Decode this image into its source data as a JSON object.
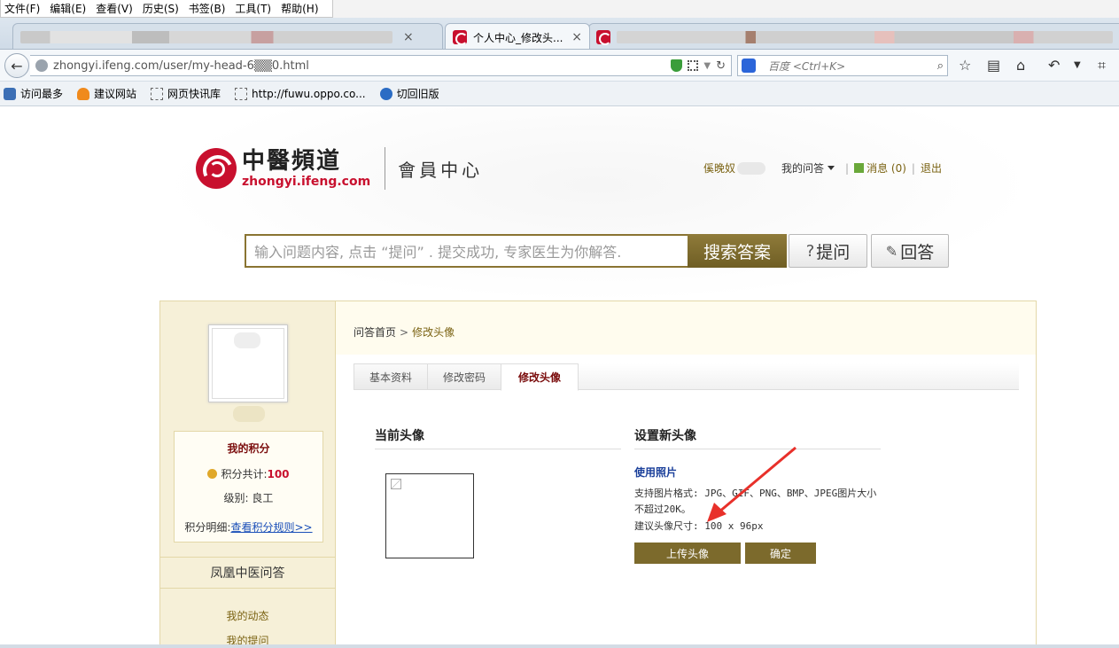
{
  "browser": {
    "menu": [
      "文件(F)",
      "编辑(E)",
      "查看(V)",
      "历史(S)",
      "书签(B)",
      "工具(T)",
      "帮助(H)"
    ],
    "tabs": [
      {
        "title": "",
        "active": false
      },
      {
        "title": "个人中心_修改头...",
        "active": true
      },
      {
        "title": "",
        "active": false
      }
    ],
    "tab_close": "×",
    "url": "zhongyi.ifeng.com/user/my-head-6▒▒0.html",
    "search_placeholder": "百度 <Ctrl+K>",
    "bookmarks": [
      {
        "label": "访问最多",
        "icon": "gear-icon"
      },
      {
        "label": "建议网站",
        "icon": "lightbulb-icon"
      },
      {
        "label": "网页快讯库",
        "icon": "dashed-page-icon"
      },
      {
        "label": "http://fuwu.oppo.co...",
        "icon": "dashed-page-icon"
      },
      {
        "label": "切回旧版",
        "icon": "refresh-icon"
      }
    ],
    "colors": {
      "chrome": "#dde6ef",
      "accent": "#c8102e"
    }
  },
  "site": {
    "logo_cn": "中醫頻道",
    "logo_en": "zhongyi.ifeng.com",
    "logo_sub": "會員中心",
    "user_name": "傒晚奴",
    "my_questions": "我的问答",
    "messages": "消息 (0)",
    "separator": "|",
    "logout": "退出",
    "search_placeholder": "输入问题内容, 点击 “提问” . 提交成功, 专家医生为你解答.",
    "search_button": "搜索答案",
    "ask_button": "提问",
    "answer_button": "回答",
    "colors": {
      "gold": "#7c6a2c",
      "cream": "#f6f0d8",
      "red": "#c8102e"
    }
  },
  "sidebar": {
    "score_title": "我的积分",
    "score_total_label": "积分共计:",
    "score_total": "100",
    "level_label": "级别:",
    "level": "良工",
    "detail_label": "积分明细:",
    "detail_link": "查看积分规则>>",
    "section_title": "凤凰中医问答",
    "links": [
      "我的动态",
      "我的提问"
    ]
  },
  "main": {
    "breadcrumb_home": "问答首页",
    "breadcrumb_sep": ">",
    "breadcrumb_current": "修改头像",
    "tabs": [
      {
        "label": "基本资料",
        "active": false
      },
      {
        "label": "修改密码",
        "active": false
      },
      {
        "label": "修改头像",
        "active": true
      }
    ],
    "current_avatar_title": "当前头像",
    "new_avatar_title": "设置新头像",
    "use_photo": "使用照片",
    "format_hint_line1": "支持图片格式: JPG、GIF、PNG、BMP、JPEG图片大小",
    "format_hint_line2": "不超过20K。",
    "size_hint": "建议头像尺寸: 100 x 96px",
    "upload_button": "上传头像",
    "confirm_button": "确定"
  }
}
